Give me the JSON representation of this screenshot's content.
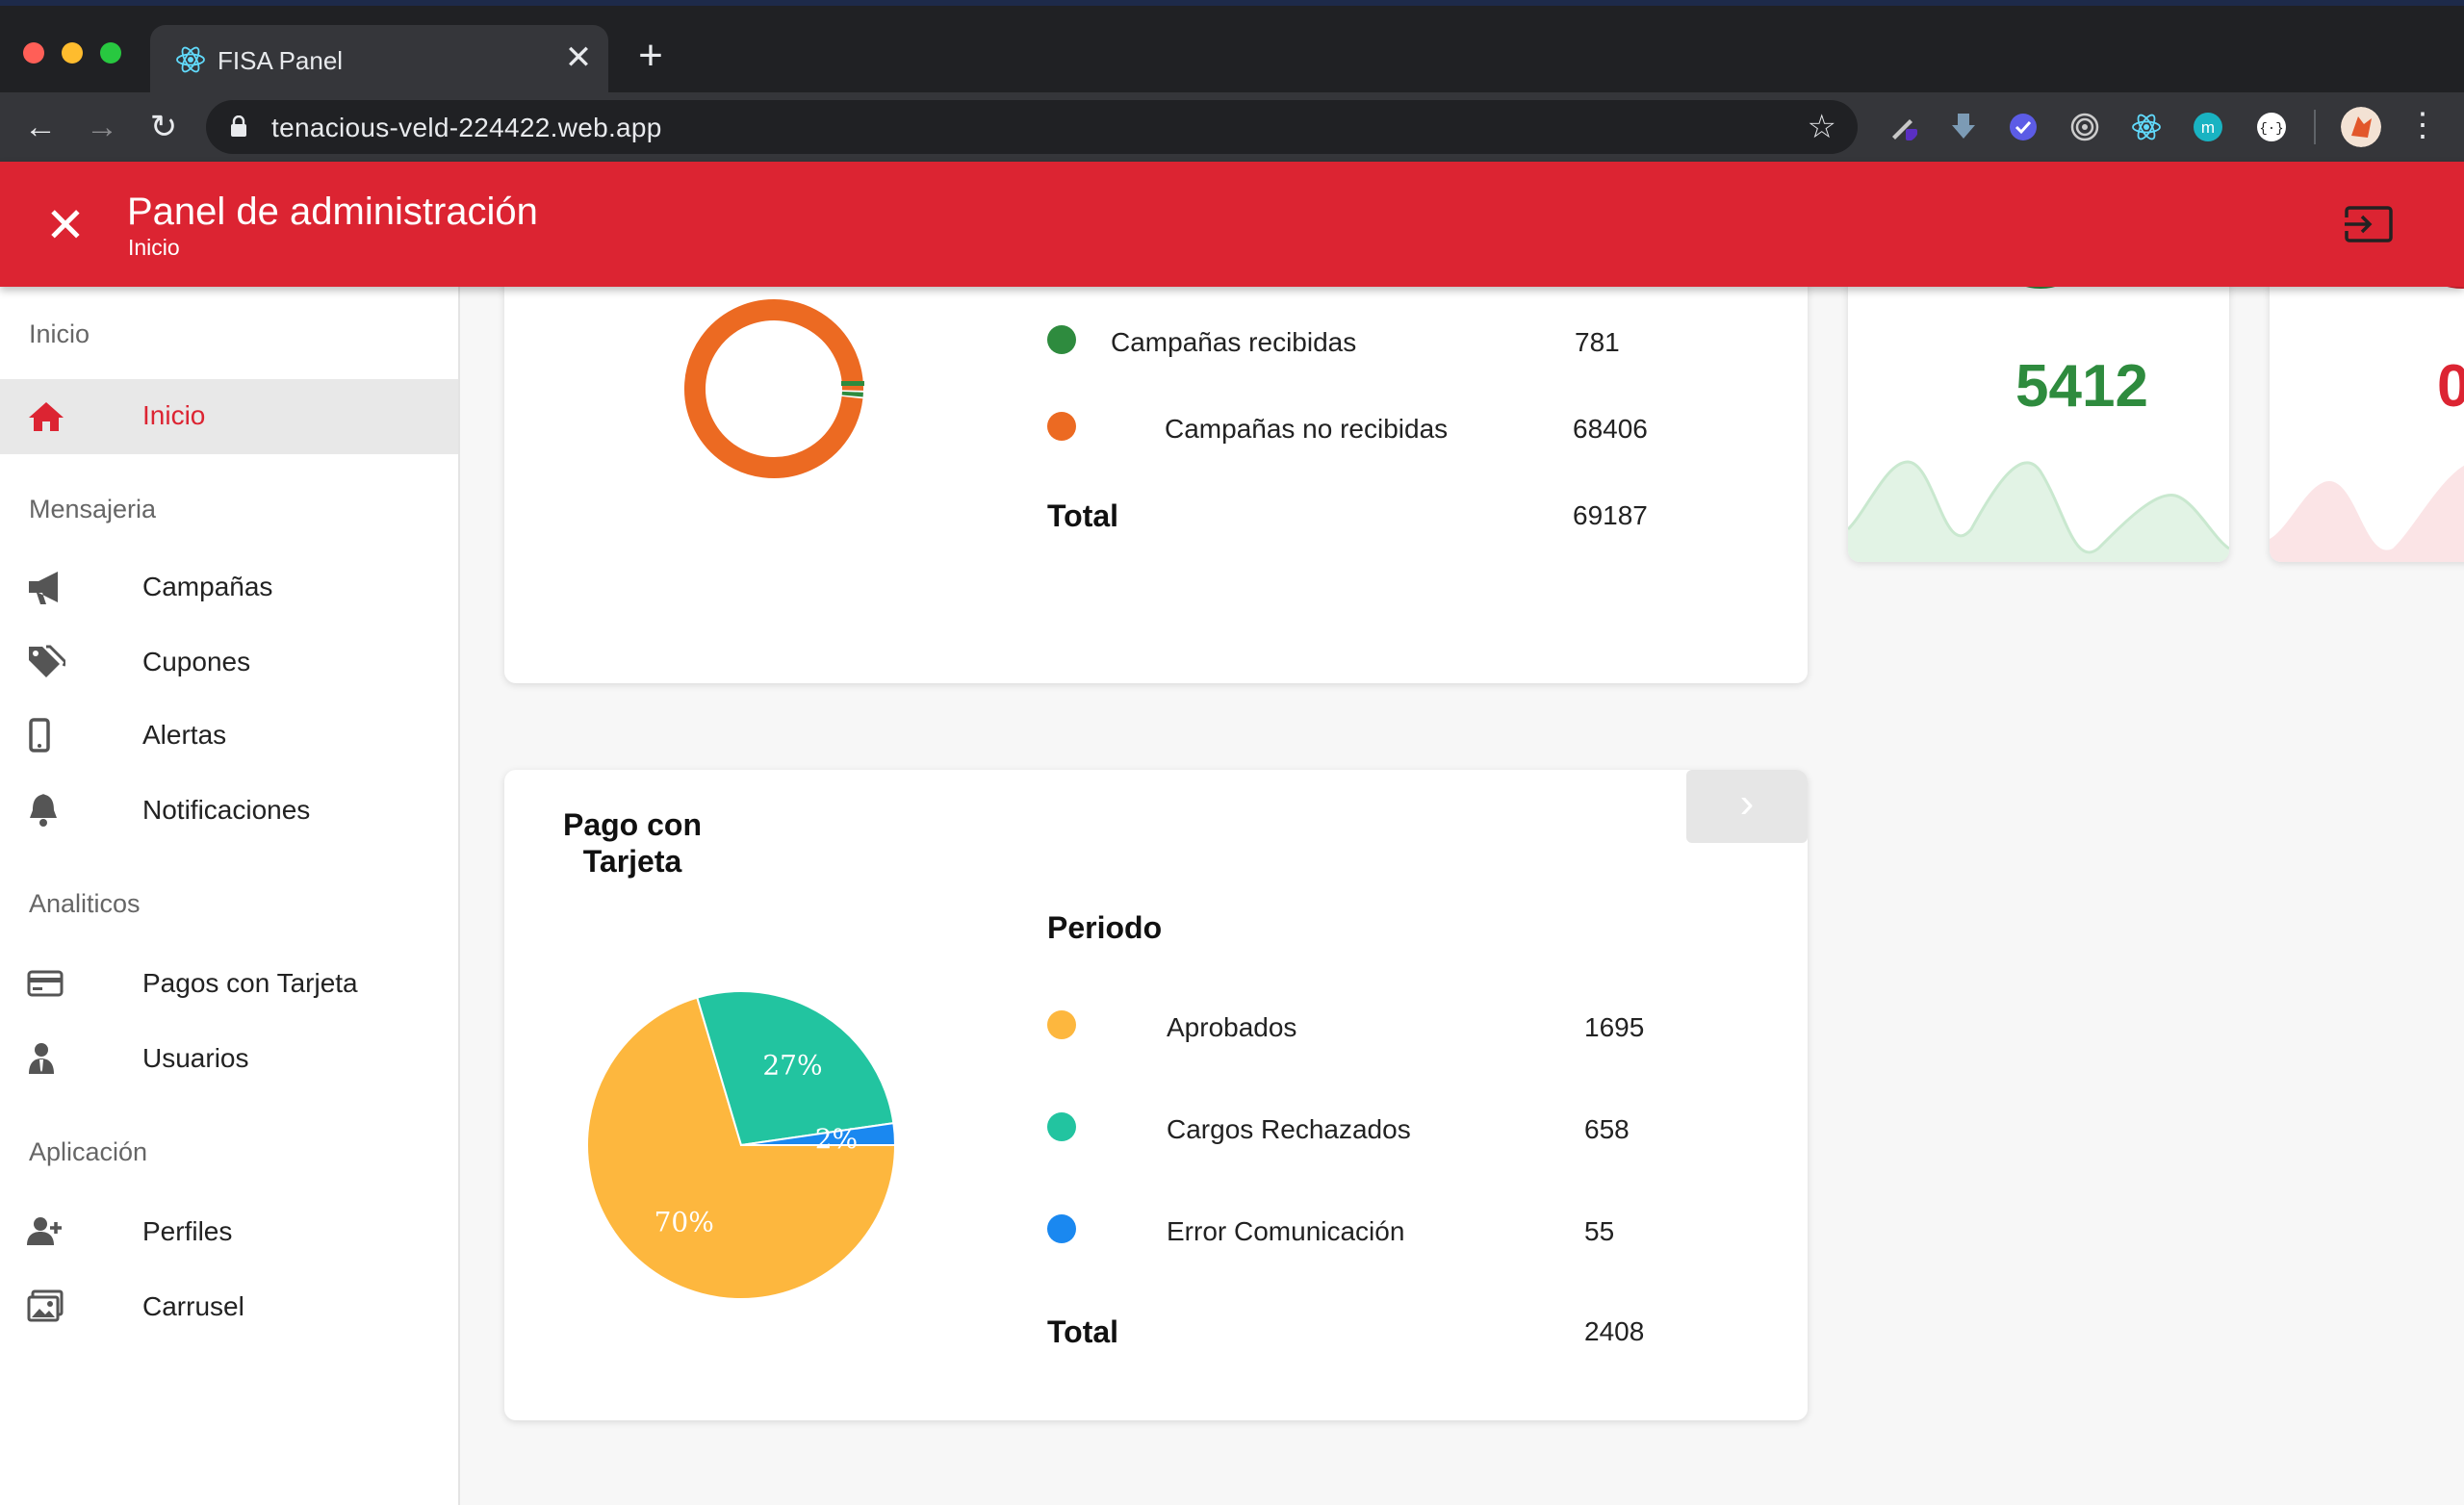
{
  "browser": {
    "tab_title": "FISA Panel",
    "tab_close": "✕",
    "new_tab": "+",
    "back": "←",
    "forward": "→",
    "reload": "↻",
    "url": "tenacious-veld-224422.web.app",
    "star": "☆",
    "menu": "⋮",
    "traffic_colors": [
      "#ff5f57",
      "#febc2e",
      "#28c840"
    ],
    "extensions": [
      "pen-extension-icon",
      "download-arrow-icon",
      "check-badge-icon",
      "target-icon",
      "react-devtools-icon",
      "m-extension-icon",
      "brackets-extension-icon",
      "profile-avatar-icon"
    ]
  },
  "header": {
    "close": "✕",
    "title": "Panel de administración",
    "subtitle": "Inicio",
    "color": "#dc2432"
  },
  "sidebar": {
    "sections": [
      "Inicio",
      "Mensajeria",
      "Analiticos",
      "Aplicación"
    ],
    "items": [
      {
        "label": "Inicio",
        "icon": "home-icon",
        "active": true
      },
      {
        "label": "Campañas",
        "icon": "megaphone-icon"
      },
      {
        "label": "Cupones",
        "icon": "tags-icon"
      },
      {
        "label": "Alertas",
        "icon": "mobile-phone-icon"
      },
      {
        "label": "Notificaciones",
        "icon": "bell-icon"
      },
      {
        "label": "Pagos con Tarjeta",
        "icon": "credit-card-icon"
      },
      {
        "label": "Usuarios",
        "icon": "user-tie-icon"
      },
      {
        "label": "Perfiles",
        "icon": "user-plus-icon"
      },
      {
        "label": "Carrusel",
        "icon": "images-icon"
      }
    ]
  },
  "campaigns_card": {
    "legend": [
      {
        "label": "Campañas recibidas",
        "value": "781",
        "color": "#2e8b3e"
      },
      {
        "label": "Campañas no recibidas",
        "value": "68406",
        "color": "#ec6a22"
      }
    ],
    "total_label": "Total",
    "total_value": "69187"
  },
  "stats": {
    "value_green": "5412",
    "value_red_partial": "0",
    "green": "#2e8b3e",
    "red": "#dc2432"
  },
  "payments_card": {
    "title_line1": "Pago con",
    "title_line2": "Tarjeta",
    "next": "›",
    "period_label": "Periodo",
    "legend": [
      {
        "label": "Aprobados",
        "value": "1695",
        "color": "#fdb73e"
      },
      {
        "label": "Cargos Rechazados",
        "value": "658",
        "color": "#22c4a0"
      },
      {
        "label": "Error Comunicación",
        "value": "55",
        "color": "#1a88f0"
      }
    ],
    "total_label": "Total",
    "total_value": "2408"
  },
  "chart_data": [
    {
      "type": "pie",
      "style": "donut",
      "categories": [
        "Campañas recibidas",
        "Campañas no recibidas"
      ],
      "values": [
        781,
        68406
      ],
      "colors": [
        "#2e8b3e",
        "#ec6a22"
      ]
    },
    {
      "type": "pie",
      "categories": [
        "Aprobados",
        "Cargos Rechazados",
        "Error Comunicación"
      ],
      "values": [
        1695,
        658,
        55
      ],
      "slice_labels": [
        "70%",
        "27%",
        "2%"
      ],
      "colors": [
        "#fdb73e",
        "#22c4a0",
        "#1a88f0"
      ]
    }
  ]
}
